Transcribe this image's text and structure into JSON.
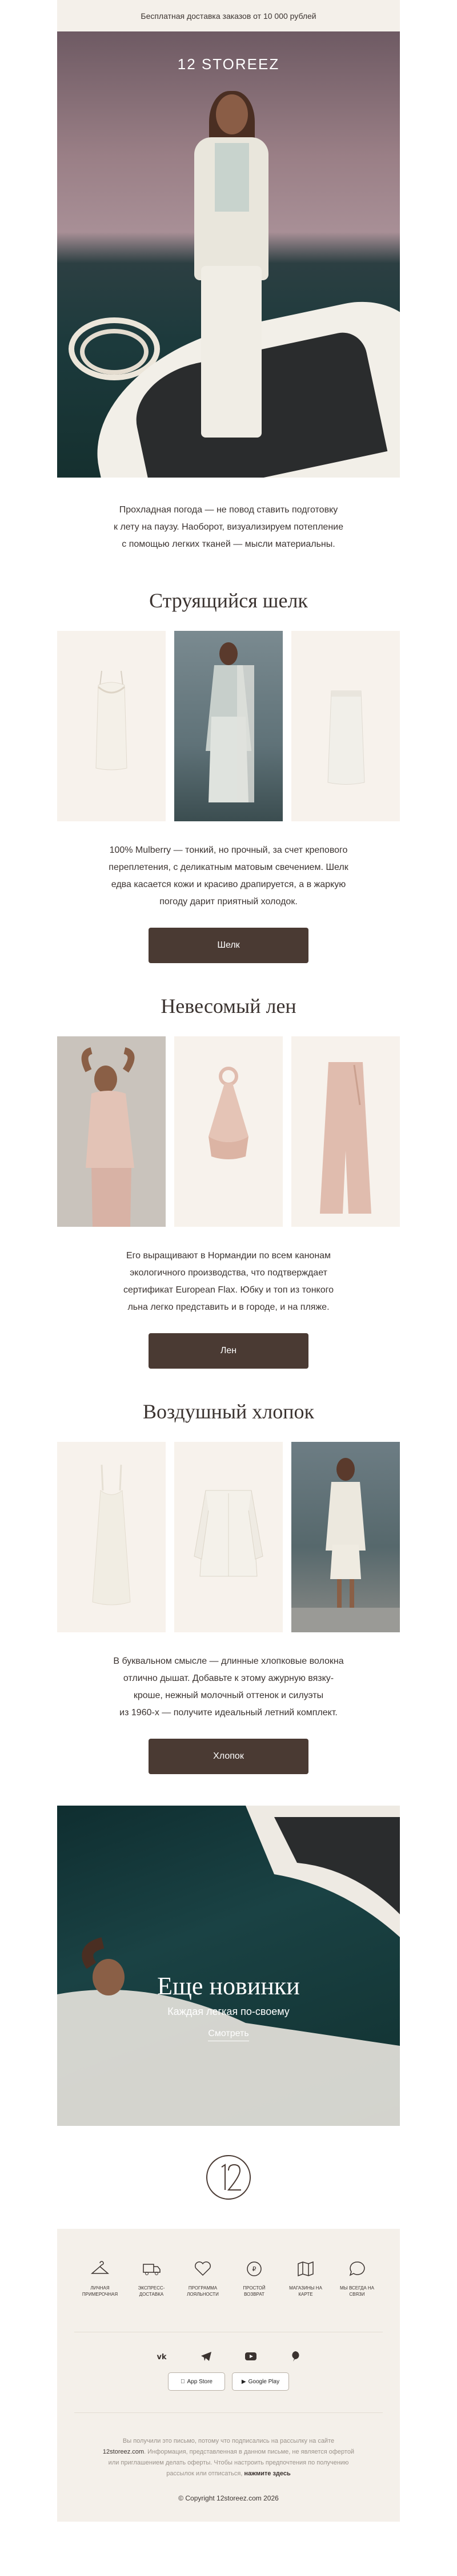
{
  "topbar": {
    "text": "Бесплатная доставка заказов от 10 000 рублей"
  },
  "hero": {
    "logo": "12 STOREEZ"
  },
  "intro": {
    "line1": "Прохладная погода — не повод ставить подготовку",
    "line2": "к лету на паузу. Наоборот, визуализируем потепление",
    "line3": "с помощью легких тканей — мысли материальны."
  },
  "silk": {
    "title": "Струящийся шелк",
    "desc": [
      "100% Mulberry — тонкий, но прочный, за счет крепового",
      "переплетения, с деликатным матовым свечением. Шелк",
      "едва касается кожи и красиво драпируется, а в жаркую",
      "погоду дарит приятный холодок."
    ],
    "button": "Шелк"
  },
  "linen": {
    "title": "Невесомый лен",
    "desc": [
      "Его выращивают в Нормандии по всем канонам",
      "экологичного производства, что подтверждает",
      "сертификат European Flax. Юбку и топ из тонкого",
      "льна легко представить и в городе, и на пляже."
    ],
    "button": "Лен"
  },
  "cotton": {
    "title": "Воздушный хлопок",
    "desc": [
      "В буквальном смысле — длинные хлопковые волокна",
      "отлично дышат. Добавьте к этому ажурную вязку-",
      "кроше, нежный молочный оттенок и силуэты",
      "из 1960-х — получите идеальный летний комплект."
    ],
    "button": "Хлопок"
  },
  "promo": {
    "title": "Еще новинки",
    "subtitle": "Каждая легкая по-своему",
    "link": "Смотреть"
  },
  "features": [
    {
      "icon": "hanger-icon",
      "label": "ЛИЧНАЯ ПРИМЕРОЧНАЯ"
    },
    {
      "icon": "delivery-truck-icon",
      "label": "ЭКСПРЕСС-ДОСТАВКА"
    },
    {
      "icon": "heart-icon",
      "label": "ПРОГРАММА ЛОЯЛЬНОСТИ"
    },
    {
      "icon": "refund-icon",
      "label": "ПРОСТОЙ ВОЗВРАТ"
    },
    {
      "icon": "map-icon",
      "label": "МАГАЗИНЫ НА КАРТЕ"
    },
    {
      "icon": "chat-icon",
      "label": "МЫ ВСЕГДА НА СВЯЗИ"
    }
  ],
  "social": [
    "vk-icon",
    "telegram-icon",
    "youtube-icon",
    "pinterest-icon"
  ],
  "stores": {
    "apple": "App Store",
    "google": "Google Play"
  },
  "legal": {
    "line1": "Вы получили это письмо, потому что подписались на рассылку на сайте",
    "site": "12storeez.com",
    "line2": ". Информация, представленная в данном письме, не является офертой",
    "line3": "или приглашением делать оферты. Чтобы настроить предпочтения по получению",
    "line4": "рассылок или отписаться,",
    "unsubscribe": "нажмите здесь",
    "copyright": "© Copyright 12storeez.com 2026"
  },
  "colors": {
    "accent": "#4a3a33",
    "beige": "#f4f0ea"
  }
}
